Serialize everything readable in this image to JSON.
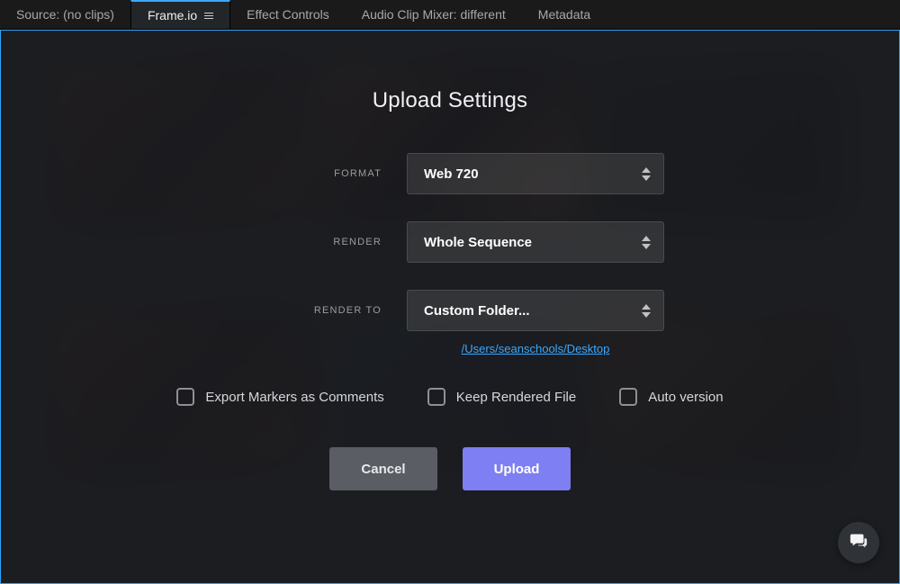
{
  "tabs": {
    "source": "Source: (no clips)",
    "frameio": "Frame.io",
    "effects": "Effect Controls",
    "audio": "Audio Clip Mixer: different",
    "metadata": "Metadata"
  },
  "modal": {
    "title": "Upload Settings",
    "labels": {
      "format": "FORMAT",
      "render": "RENDER",
      "render_to": "RENDER TO"
    },
    "values": {
      "format": "Web 720",
      "render": "Whole Sequence",
      "render_to": "Custom Folder..."
    },
    "path": "/Users/seanschools/Desktop",
    "checks": {
      "export_markers": "Export Markers as Comments",
      "keep_rendered": "Keep Rendered File",
      "auto_version": "Auto version"
    },
    "buttons": {
      "cancel": "Cancel",
      "upload": "Upload"
    }
  }
}
